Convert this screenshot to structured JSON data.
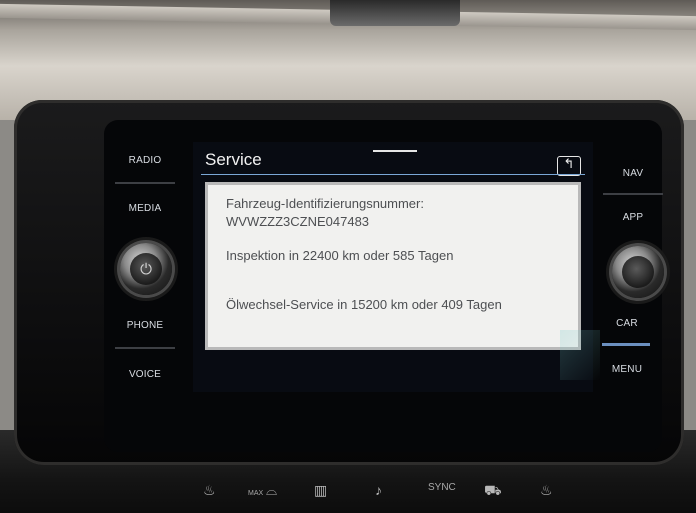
{
  "hardware_buttons": {
    "left": [
      "RADIO",
      "MEDIA",
      "PHONE",
      "VOICE"
    ],
    "right": [
      "NAV",
      "APP",
      "CAR",
      "MENU"
    ]
  },
  "screen": {
    "title": "Service",
    "back_icon": "back-arrow-icon",
    "vin_label": "Fahrzeug-Identifizierungsnummer:",
    "vin_value": "WVWZZZ3CZNE047483",
    "inspection_text": "Inspektion in 22400 km oder 585 Tagen",
    "oil_service_text": "Ölwechsel-Service in 15200 km oder 409 Tagen"
  },
  "climate_bar": {
    "max_label": "MAX",
    "sync_label": "SYNC",
    "icons": [
      "seat-heat-icon",
      "defrost-icon",
      "rear-defrost-icon",
      "seat-vent-icon",
      "sync-label",
      "car-recirculation-icon",
      "seat-heat-right-icon"
    ]
  },
  "colors": {
    "screen_bg": "#080b12",
    "panel_bg": "#f1f1ef",
    "title_rule": "#7aa7d6",
    "menu_accent": "#6b8fbf"
  }
}
